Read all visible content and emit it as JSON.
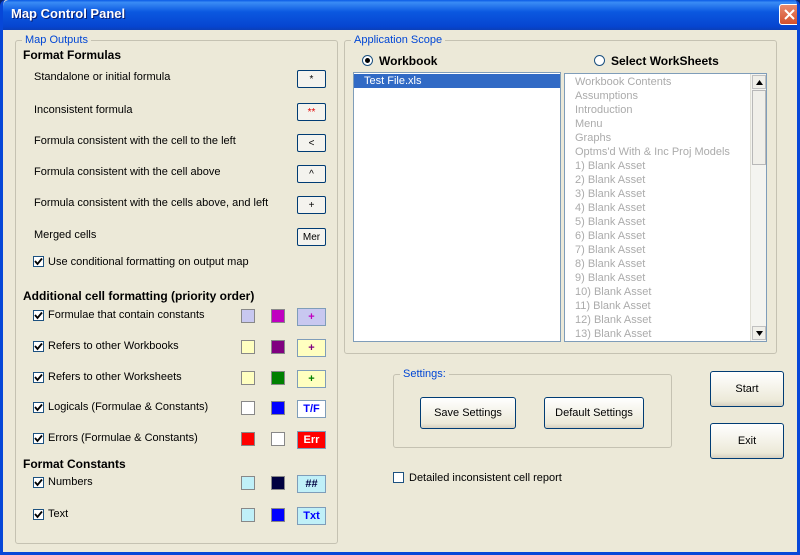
{
  "window": {
    "title": "Map Control Panel"
  },
  "map_outputs": {
    "legend": "Map Outputs",
    "format_formulas_heading": "Format Formulas",
    "formula_rows": [
      {
        "label": "Standalone or initial formula",
        "button": "*",
        "btn_color": "#000000"
      },
      {
        "label": "Inconsistent formula",
        "button": "**",
        "btn_color": "#e00000"
      },
      {
        "label": "Formula consistent with the cell to the left",
        "button": "<",
        "btn_color": "#000000"
      },
      {
        "label": "Formula consistent with the cell above",
        "button": "^",
        "btn_color": "#000000"
      },
      {
        "label": "Formula consistent with the cells above, and  left",
        "button": "+",
        "btn_color": "#000000"
      },
      {
        "label": "Merged cells",
        "button": "Mer",
        "btn_color": "#000000"
      }
    ],
    "conditional_checkbox": {
      "label": "Use conditional formatting on output map",
      "checked": true
    },
    "additional_heading": "Additional cell formatting (priority order)",
    "additional_rows": [
      {
        "label": "Formulae that contain constants",
        "checked": true,
        "fill": "#c8c8f0",
        "font": "#c000c0",
        "preview": "+",
        "preview_bg": "#c8c8f0",
        "preview_fg": "#c000c0"
      },
      {
        "label": "Refers to other Workbooks",
        "checked": true,
        "fill": "#ffffc0",
        "font": "#800080",
        "preview": "+",
        "preview_bg": "#ffffc0",
        "preview_fg": "#800080"
      },
      {
        "label": "Refers to other Worksheets",
        "checked": true,
        "fill": "#ffffc0",
        "font": "#008000",
        "preview": "+",
        "preview_bg": "#ffffc0",
        "preview_fg": "#008000"
      },
      {
        "label": "Logicals (Formulae & Constants)",
        "checked": true,
        "fill": "#ffffff",
        "font": "#0000ff",
        "preview": "T/F",
        "preview_bg": "#ffffff",
        "preview_fg": "#0000ff"
      },
      {
        "label": "Errors (Formulae & Constants)",
        "checked": true,
        "fill": "#ff0000",
        "font": "#ffffff",
        "preview": "Err",
        "preview_bg": "#ff0000",
        "preview_fg": "#ffffff"
      }
    ],
    "format_constants_heading": "Format Constants",
    "constant_rows": [
      {
        "label": "Numbers",
        "checked": true,
        "fill": "#c0f0f8",
        "font": "#000040",
        "preview": "##",
        "preview_bg": "#c0f0f8",
        "preview_fg": "#000040"
      },
      {
        "label": "Text",
        "checked": true,
        "fill": "#c0f0f8",
        "font": "#0000ff",
        "preview": "Txt",
        "preview_bg": "#c0f0f8",
        "preview_fg": "#0000ff"
      }
    ]
  },
  "application_scope": {
    "legend": "Application Scope",
    "radio_workbook": {
      "label": "Workbook",
      "selected": true
    },
    "radio_worksheets": {
      "label": "Select WorkSheets",
      "selected": false
    },
    "workbook_list": [
      "Test File.xls"
    ],
    "worksheet_list": [
      "Workbook Contents",
      "Assumptions",
      "Introduction",
      "Menu",
      "Graphs",
      "Optms'd With & Inc Proj Models",
      "1) Blank Asset",
      "2) Blank Asset",
      "3) Blank Asset",
      "4) Blank Asset",
      "5) Blank Asset",
      "6) Blank Asset",
      "7) Blank Asset",
      "8) Blank Asset",
      "9) Blank Asset",
      "10) Blank Asset",
      "11) Blank Asset",
      "12) Blank Asset",
      "13) Blank Asset"
    ]
  },
  "settings": {
    "legend": "Settings:",
    "save_label": "Save Settings",
    "default_label": "Default  Settings"
  },
  "detailed_report": {
    "label": "Detailed inconsistent cell report",
    "checked": false
  },
  "buttons": {
    "start": "Start",
    "exit": "Exit"
  }
}
